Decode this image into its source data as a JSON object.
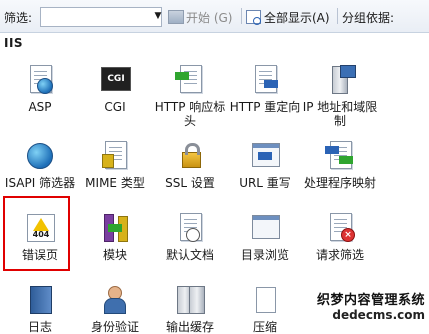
{
  "toolbar": {
    "filter_label": "筛选:",
    "filter_value": "",
    "dropdown_glyph": "▼",
    "start_label": "开始 (G)",
    "show_all_label": "全部显示(A)",
    "group_by_label": "分组依据:"
  },
  "section_title": "IIS",
  "features": [
    {
      "label": "ASP",
      "icon": "asp-icon"
    },
    {
      "label": "CGI",
      "icon": "cgi-icon",
      "icon_text": "CGI"
    },
    {
      "label": "HTTP 响应标头",
      "icon": "http-response-headers-icon"
    },
    {
      "label": "HTTP 重定向",
      "icon": "http-redirect-icon"
    },
    {
      "label": "IP 地址和域限制",
      "icon": "ip-domain-restrictions-icon"
    },
    {
      "label": "ISAPI 筛选器",
      "icon": "isapi-filters-icon"
    },
    {
      "label": "MIME 类型",
      "icon": "mime-types-icon"
    },
    {
      "label": "SSL 设置",
      "icon": "ssl-settings-icon"
    },
    {
      "label": "URL 重写",
      "icon": "url-rewrite-icon"
    },
    {
      "label": "处理程序映射",
      "icon": "handler-mappings-icon"
    },
    {
      "label": "错误页",
      "icon": "error-pages-icon",
      "icon_text": "404"
    },
    {
      "label": "模块",
      "icon": "modules-icon"
    },
    {
      "label": "默认文档",
      "icon": "default-document-icon"
    },
    {
      "label": "目录浏览",
      "icon": "directory-browsing-icon"
    },
    {
      "label": "请求筛选",
      "icon": "request-filtering-icon"
    },
    {
      "label": "日志",
      "icon": "logging-icon"
    },
    {
      "label": "身份验证",
      "icon": "authentication-icon"
    },
    {
      "label": "输出缓存",
      "icon": "output-caching-icon"
    },
    {
      "label": "压缩",
      "icon": "compression-icon"
    }
  ],
  "highlight_color": "#e00000",
  "watermark": {
    "line1": "织梦内容管理系统",
    "line2": "dedecms.com"
  }
}
